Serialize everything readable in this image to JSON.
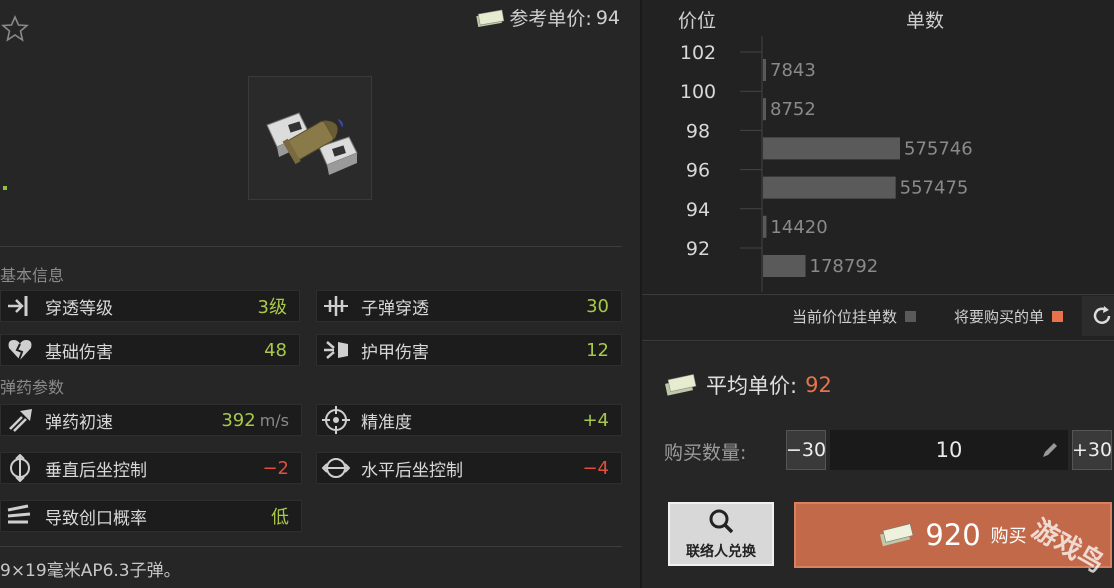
{
  "header": {
    "ref_price_label": "参考单价:",
    "ref_price_value": "94"
  },
  "sections": {
    "basic_info": "基本信息",
    "ammo_params": "弹药参数"
  },
  "stats": {
    "penetration_level": {
      "label": "穿透等级",
      "value": "3级",
      "icon": "penetration-icon"
    },
    "bullet_penetration": {
      "label": "子弹穿透",
      "value": "30",
      "icon": "bullet-pierce-icon"
    },
    "base_damage": {
      "label": "基础伤害",
      "value": "48",
      "icon": "broken-heart-icon"
    },
    "armor_damage": {
      "label": "护甲伤害",
      "value": "12",
      "icon": "armor-hit-icon"
    },
    "muzzle_velocity": {
      "label": "弹药初速",
      "value": "392",
      "unit": "m/s",
      "icon": "velocity-icon"
    },
    "accuracy": {
      "label": "精准度",
      "value": "+4",
      "icon": "crosshair-icon"
    },
    "vertical_recoil": {
      "label": "垂直后坐控制",
      "value": "−2",
      "icon": "vertical-recoil-icon"
    },
    "horizontal_recoil": {
      "label": "水平后坐控制",
      "value": "−4",
      "icon": "horizontal-recoil-icon"
    },
    "bleed_chance": {
      "label": "导致创口概率",
      "value": "低",
      "icon": "bleed-icon"
    }
  },
  "description": "9×19毫米AP6.3子弹。",
  "market": {
    "col_price": "价位",
    "col_orders": "单数",
    "legend_current": "当前价位挂单数",
    "legend_buy": "将要购买的单",
    "colors": {
      "current": "#5a5a5a",
      "buy": "#e8734a"
    }
  },
  "chart_data": {
    "type": "bar",
    "orientation": "horizontal",
    "price_ticks": [
      "102",
      "100",
      "98",
      "96",
      "94",
      "92"
    ],
    "bars": [
      {
        "label": "7843",
        "value": 7843
      },
      {
        "label": "8752",
        "value": 8752
      },
      {
        "label": "575746",
        "value": 575746
      },
      {
        "label": "557475",
        "value": 557475
      },
      {
        "label": "14420",
        "value": 14420
      },
      {
        "label": "178792",
        "value": 178792
      }
    ]
  },
  "purchase": {
    "avg_label": "平均单价:",
    "avg_value": "92",
    "qty_label": "购买数量:",
    "minus_label": "−30",
    "plus_label": "+30",
    "qty_value": "10",
    "contact_label": "联络人兑换",
    "buy_total": "920",
    "buy_label": "购买"
  },
  "watermark": "游戏鸟"
}
